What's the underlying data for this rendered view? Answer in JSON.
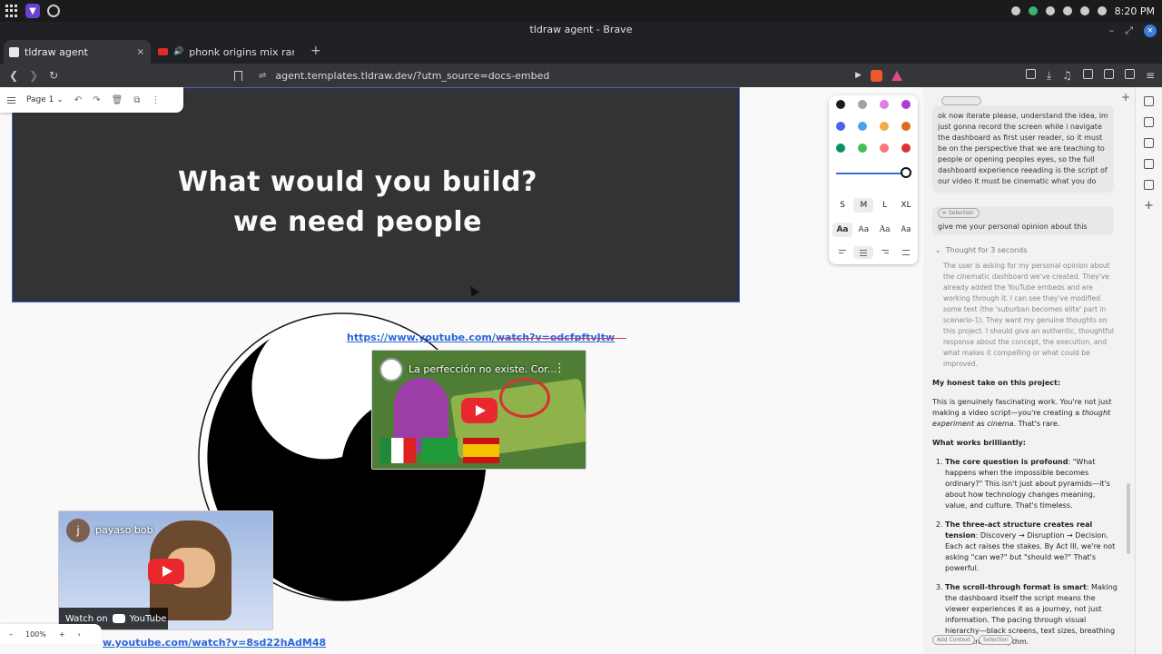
{
  "os": {
    "clock": "8:20 PM"
  },
  "window": {
    "title": "tldraw agent - Brave",
    "min": "–",
    "max": "⤢",
    "close": "×"
  },
  "tabs": [
    {
      "label": "tldraw agent",
      "close": "×"
    },
    {
      "label": "phonk origins mix rare ph",
      "audio": "🔊"
    }
  ],
  "newtab": "+",
  "toolbar": {
    "back": "❮",
    "forward": "❯",
    "reload": "↻",
    "tune": "⇌",
    "url": "agent.templates.tldraw.dev/?utm_source=docs-embed",
    "play": "▶",
    "download": "⤓",
    "music": "♫",
    "menu": "≡"
  },
  "canvas": {
    "page_label": "Page 1",
    "page_chevron": "⌄",
    "undo": "↶",
    "redo": "↷",
    "delete": "🗑",
    "duplicate": "⧉",
    "more": "⋮",
    "frame_line1": "What would you build?",
    "frame_line2": "we need people",
    "link1": "https://www.youtube.com/watch?v=odcfpftvJtw",
    "link2": "w.youtube.com/watch?v=8sd22hAdM48",
    "zoom_minus": "–",
    "zoom": "100%",
    "zoom_plus": "+",
    "zoom_collapse": "‹"
  },
  "video1": {
    "title": "La perfección no existe. Cor...",
    "more": "⋮"
  },
  "video2": {
    "avatar_letter": "j",
    "title": "payaso bob",
    "watch_on": "Watch on",
    "yt_label": "YouTube"
  },
  "style_panel": {
    "colors": [
      "#1d1d1d",
      "#9ea3a8",
      "#e07ce0",
      "#ae3ec9",
      "#4465e9",
      "#4ba1f1",
      "#f1ac4b",
      "#e16919",
      "#099268",
      "#40c057",
      "#f87777",
      "#e03131"
    ],
    "sizes": [
      "S",
      "M",
      "L",
      "XL"
    ],
    "fonts": [
      "Aa",
      "Aa",
      "Aa",
      "Aa"
    ]
  },
  "chat": {
    "new_chat": "+",
    "message1": "ok now iterate please, understand the idea, im just gonna record the screen while i navigate the dashboard as first user reader, so it must be on the perspective that we are teaching to people or opening peoples eyes, so the full dashboard experience reeading is the script of our video it must be cinematic what you do",
    "selection_chip": "Selection",
    "message2": "give me your personal opinion about this",
    "thought_label": "Thought for 3 seconds",
    "thinking": "The user is asking for my personal opinion about the cinematic dashboard we've created. They've already added the YouTube embeds and are working through it. I can see they've modified some text (the 'suburban becomes elite' part in scenario-1). They want my genuine thoughts on this project. I should give an authentic, thoughtful response about the concept, the execution, and what makes it compelling or what could be improved.",
    "heading": "My honest take on this project:",
    "intro_pre": "This is genuinely fascinating work. You're not just making a video script—you're creating a ",
    "intro_em": "thought experiment as cinema",
    "intro_post": ". That's rare.",
    "works_heading": "What works brilliantly:",
    "points": [
      {
        "title": "The core question is profound",
        "body": ": \"What happens when the impossible becomes ordinary?\" This isn't just about pyramids—it's about how technology changes meaning, value, and culture. That's timeless."
      },
      {
        "title": "The three-act structure creates real tension",
        "body": ": Discovery → Disruption → Decision. Each act raises the stakes. By Act III, we're not asking \"can we?\" but \"should we?\" That's powerful."
      },
      {
        "title": "The scroll-through format is smart",
        "body": ": Making the dashboard itself the script means the viewer experiences it as a journey, not just information. The pacing through visual hierarchy—black screens, text sizes, breathing room—creates rhythm."
      }
    ],
    "chip_add_context": "Add Context",
    "chip_selection": "Selection"
  }
}
